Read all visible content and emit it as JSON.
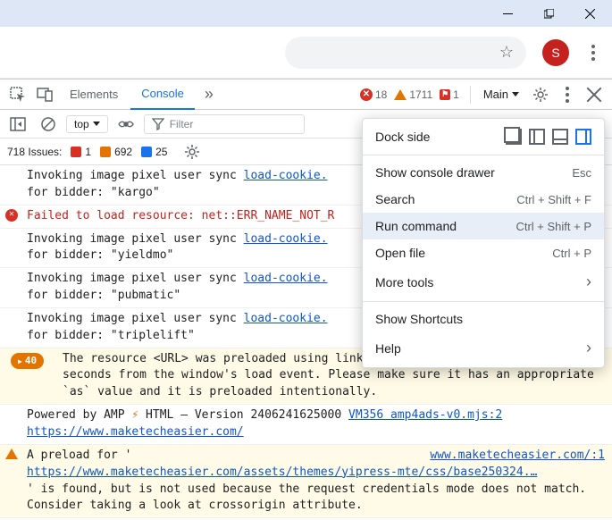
{
  "window": {
    "avatar_initial": "S"
  },
  "devtools": {
    "tabs": {
      "elements": "Elements",
      "console": "Console"
    },
    "stats": {
      "errors": "18",
      "warnings": "1711",
      "flags": "1"
    },
    "context": "Main"
  },
  "console_toolbar": {
    "top_select": "top",
    "filter_placeholder": "Filter"
  },
  "issues": {
    "label": "718 Issues:",
    "red": "1",
    "orange": "692",
    "blue": "25"
  },
  "logs": {
    "l0a": "Invoking image pixel user sync  ",
    "l0link": "load-cookie.",
    "l0b": "for bidder: \"kargo\"",
    "err": "Failed to load resource: net::ERR_NAME_NOT_R",
    "l1a": "Invoking image pixel user sync  ",
    "l1link": "load-cookie.",
    "l1b": "for bidder: \"yieldmo\"",
    "l2a": "Invoking image pixel user sync  ",
    "l2link": "load-cookie.",
    "l2b": "for bidder: \"pubmatic\"",
    "l3a": "Invoking image pixel user sync  ",
    "l3link": "load-cookie.",
    "l3b": "for bidder: \"triplelift\"",
    "pill": "40",
    "preload_warn": "The resource <URL> was preloaded using link preload but not used within a few seconds from the window's load event. Please make sure it has an appropriate `as` value and it is preloaded intentionally.",
    "amp_a": "Powered by AMP ",
    "amp_b": " HTML – Version 2406241625000   ",
    "amp_link": "VM356 amp4ads-v0.mjs:2",
    "amp_url": "https://www.maketecheasier.com/",
    "preload2_a": "A preload for '",
    "preload2_link1": "www.maketecheasier.com/:1",
    "preload2_link2": "https://www.maketecheasier.com/assets/themes/yipress-mte/css/base250324.…",
    "preload2_b": "' is found, but is not used because the request credentials mode does not match. Consider taking a look at crossorigin attribute."
  },
  "menu": {
    "dock": "Dock side",
    "drawer": "Show console drawer",
    "drawer_sc": "Esc",
    "search": "Search",
    "search_sc": "Ctrl + Shift + F",
    "run": "Run command",
    "run_sc": "Ctrl + Shift + P",
    "open": "Open file",
    "open_sc": "Ctrl + P",
    "more": "More tools",
    "shortcuts": "Show Shortcuts",
    "help": "Help"
  }
}
